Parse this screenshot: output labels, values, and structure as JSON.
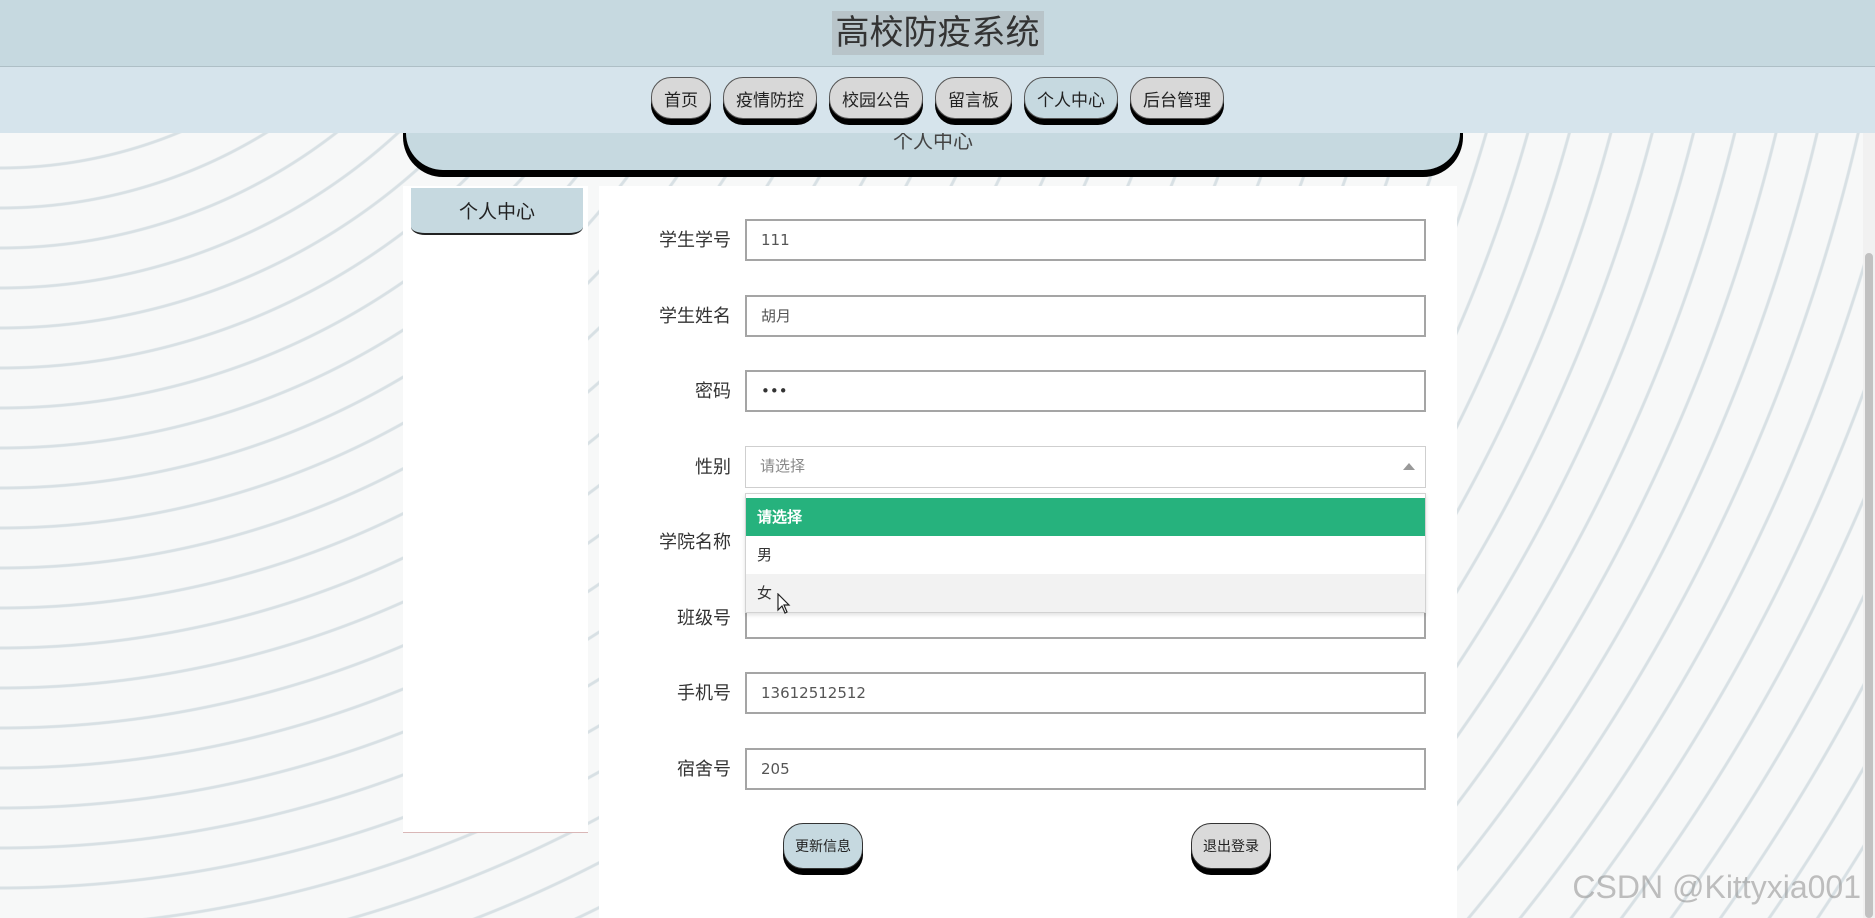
{
  "header": {
    "title": "高校防疫系统"
  },
  "nav": {
    "items": [
      "首页",
      "疫情防控",
      "校园公告",
      "留言板",
      "个人中心",
      "后台管理"
    ]
  },
  "section": {
    "title": "个人中心"
  },
  "sidebar": {
    "items": [
      "个人中心"
    ]
  },
  "form": {
    "student_id": {
      "label": "学生学号",
      "value": "111"
    },
    "student_name": {
      "label": "学生姓名",
      "value": "胡月"
    },
    "password": {
      "label": "密码",
      "value": "•••"
    },
    "gender": {
      "label": "性别",
      "placeholder": "请选择",
      "options": [
        "请选择",
        "男",
        "女"
      ]
    },
    "college": {
      "label": "学院名称"
    },
    "class_no": {
      "label": "班级号"
    },
    "phone": {
      "label": "手机号",
      "value": "13612512512"
    },
    "dorm": {
      "label": "宿舍号",
      "value": "205"
    }
  },
  "actions": {
    "update_label": "更新信息",
    "logout_label": "退出登录"
  },
  "colors": {
    "header_bg": "#c6d9e0",
    "nav_bg": "#d6e4ec",
    "selected_option": "#26b27d"
  },
  "watermark": "CSDN @Kittyxia001"
}
